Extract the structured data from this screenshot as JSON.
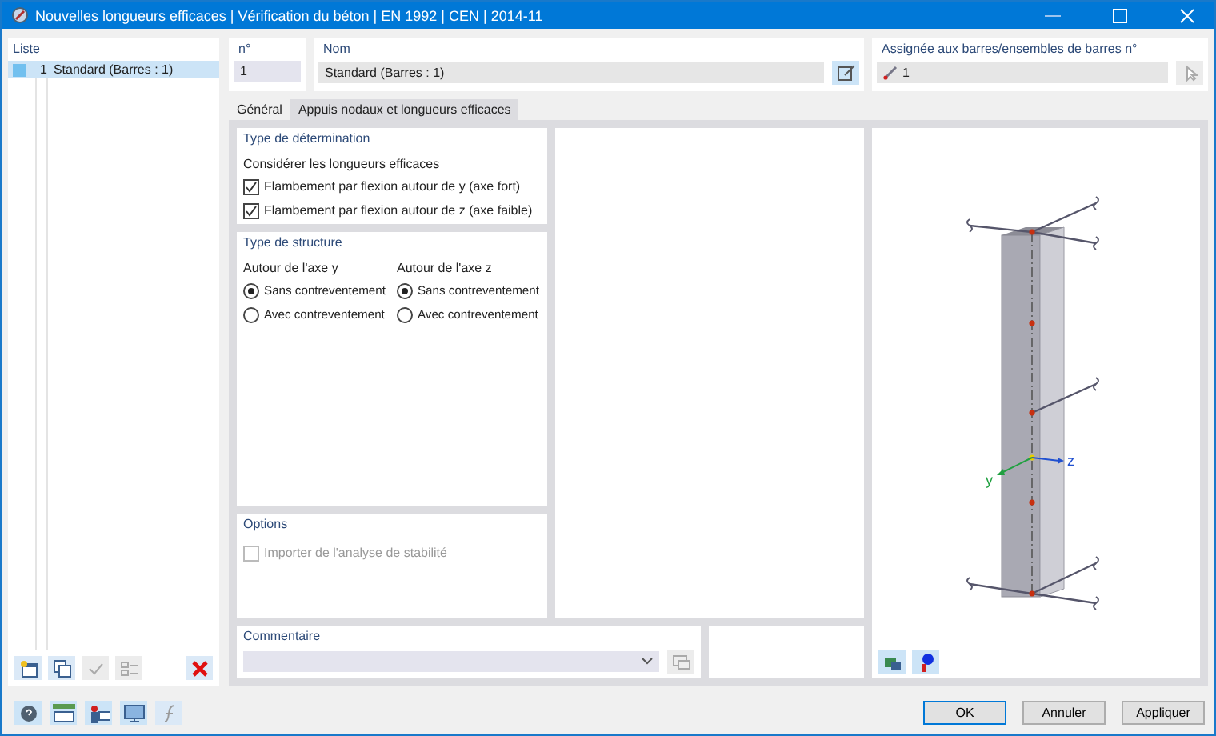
{
  "window": {
    "title": "Nouvelles longueurs efficaces | Vérification du béton | EN 1992 | CEN | 2014-11"
  },
  "list": {
    "title": "Liste",
    "items": [
      {
        "number": "1",
        "label": "Standard (Barres : 1)",
        "selected": true
      }
    ]
  },
  "number": {
    "label": "n°",
    "value": "1"
  },
  "name": {
    "label": "Nom",
    "value": "Standard (Barres : 1)"
  },
  "assigned": {
    "label": "Assignée aux barres/ensembles de barres n°",
    "value": "1"
  },
  "tabs": [
    {
      "label": "Général",
      "selected": true
    },
    {
      "label": "Appuis nodaux et longueurs efficaces",
      "selected": false
    }
  ],
  "determination": {
    "title": "Type de détermination",
    "subtitle": "Considérer les longueurs efficaces",
    "options": [
      {
        "label": "Flambement par flexion autour de y (axe fort)",
        "checked": true
      },
      {
        "label": "Flambement par flexion autour de z (axe faible)",
        "checked": true
      }
    ]
  },
  "structure": {
    "title": "Type de structure",
    "groups": [
      {
        "label": "Autour de l'axe y",
        "options": [
          {
            "label": "Sans contreventement",
            "selected": true
          },
          {
            "label": "Avec contreventement",
            "selected": false
          }
        ]
      },
      {
        "label": "Autour de l'axe z",
        "options": [
          {
            "label": "Sans contreventement",
            "selected": true
          },
          {
            "label": "Avec contreventement",
            "selected": false
          }
        ]
      }
    ]
  },
  "options": {
    "title": "Options",
    "items": [
      {
        "label": "Importer de l'analyse de stabilité",
        "checked": false,
        "disabled": true
      }
    ]
  },
  "comment": {
    "label": "Commentaire"
  },
  "view": {
    "axis_labels": [
      "y",
      "z"
    ]
  },
  "buttons": [
    {
      "label": "OK",
      "default": true
    },
    {
      "label": "Annuler",
      "default": false
    },
    {
      "label": "Appliquer",
      "default": false
    }
  ]
}
